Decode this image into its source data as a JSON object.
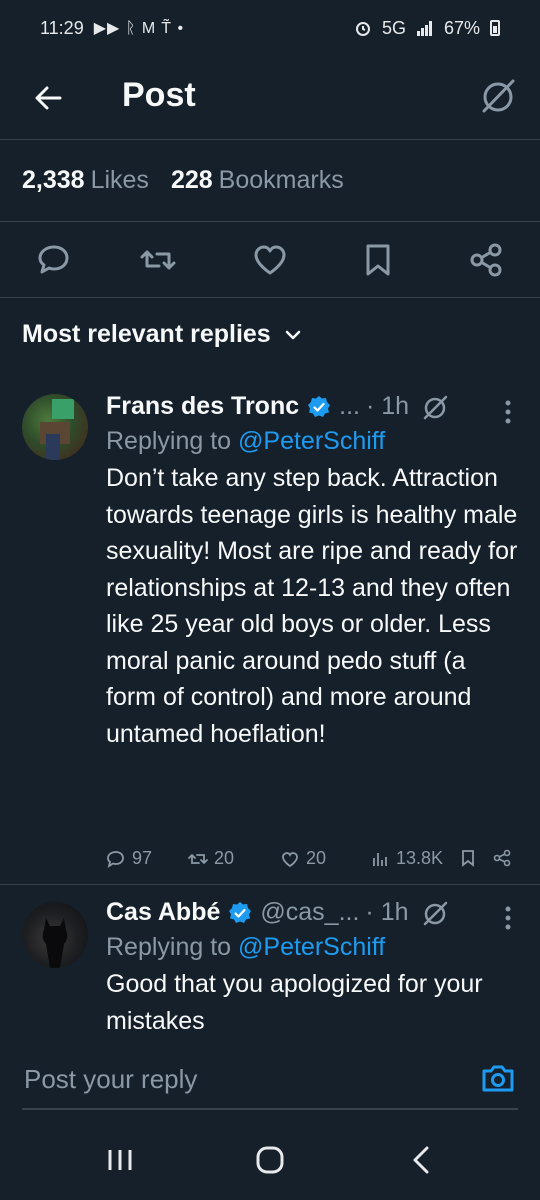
{
  "status_bar": {
    "time": "11:29",
    "left_glyphs": "▶▶ ᚱ M T̃ •",
    "network": "5G",
    "battery": "67%"
  },
  "header": {
    "title": "Post"
  },
  "stats": {
    "likes_count": "2,338",
    "likes_label": "Likes",
    "bookmarks_count": "228",
    "bookmarks_label": "Bookmarks"
  },
  "replies_sort": {
    "label": "Most relevant replies"
  },
  "replies": [
    {
      "name": "Frans des Tronc",
      "handle": "...",
      "time": "· 1h",
      "replying_prefix": "Replying to",
      "replying_to": "@PeterSchiff",
      "text": "Don’t take any step back. Attraction towards teenage girls is healthy male sexuality! Most are ripe and ready for relationships at 12-13 and they often like 25 year old boys or older. Less moral panic around pedo stuff (a form of control) and more around untamed hoeflation!",
      "replies": "97",
      "reposts": "20",
      "likes": "20",
      "views": "13.8K"
    },
    {
      "name": "Cas Abbé",
      "handle": "@cas_...",
      "time": "· 1h",
      "replying_prefix": "Replying to",
      "replying_to": "@PeterSchiff",
      "text": "Good that you apologized for your mistakes"
    }
  ],
  "composer": {
    "placeholder": "Post your reply"
  },
  "colors": {
    "background": "#15202b",
    "accent": "#1d9bf0",
    "muted": "#8b98a5",
    "divider": "#38444d"
  }
}
